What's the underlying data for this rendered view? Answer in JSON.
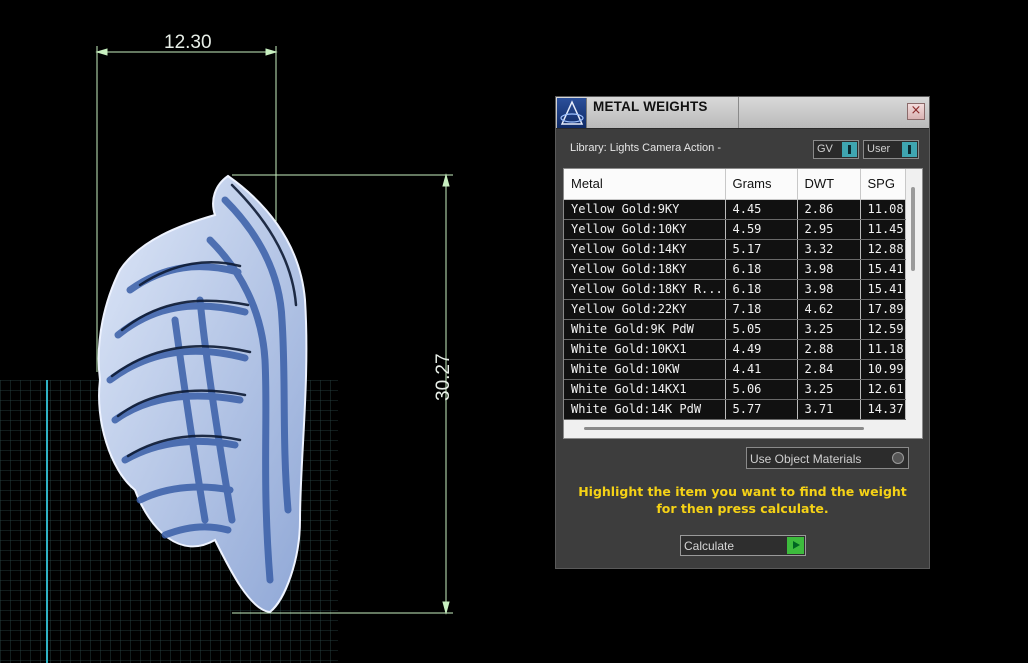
{
  "viewport": {
    "width_dimension": "12.30",
    "height_dimension": "30.27"
  },
  "panel": {
    "title": "METAL WEIGHTS",
    "close_glyph": "×",
    "library_label": "Library: Lights Camera Action -",
    "toggles": {
      "gv_label": "GV",
      "user_label": "User"
    },
    "table": {
      "columns": [
        "Metal",
        "Grams",
        "DWT",
        "SPG"
      ],
      "rows": [
        [
          "Yellow Gold:9KY",
          "4.45",
          "2.86",
          "11.08"
        ],
        [
          "Yellow Gold:10KY",
          "4.59",
          "2.95",
          "11.45"
        ],
        [
          "Yellow Gold:14KY",
          "5.17",
          "3.32",
          "12.88"
        ],
        [
          "Yellow Gold:18KY",
          "6.18",
          "3.98",
          "15.41"
        ],
        [
          "Yellow Gold:18KY R...",
          "6.18",
          "3.98",
          "15.41"
        ],
        [
          "Yellow Gold:22KY",
          "7.18",
          "4.62",
          "17.89"
        ],
        [
          "White Gold:9K PdW",
          "5.05",
          "3.25",
          "12.59"
        ],
        [
          "White Gold:10KX1",
          "4.49",
          "2.88",
          "11.18"
        ],
        [
          "White Gold:10KW",
          "4.41",
          "2.84",
          "10.99"
        ],
        [
          "White Gold:14KX1",
          "5.06",
          "3.25",
          "12.61"
        ],
        [
          "White Gold:14K PdW",
          "5.77",
          "3.71",
          "14.37"
        ]
      ]
    },
    "use_object_materials_label": "Use Object Materials",
    "instruction": "Highlight the item you want to find the weight for then press calculate.",
    "calculate_label": "Calculate"
  },
  "colors": {
    "instruction_text": "#f5d216",
    "toggle_accent": "#3fa5b0",
    "calculate_accent": "#3dbb3d",
    "dimension_lines": "#c8f0c0",
    "wing_fill": "#b7c8e8"
  }
}
